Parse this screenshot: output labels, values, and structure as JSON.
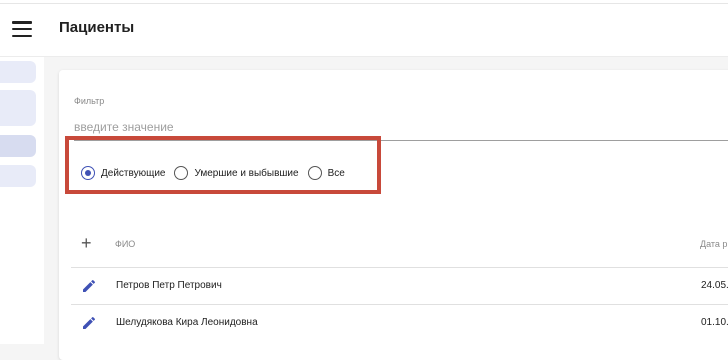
{
  "header": {
    "title": "Пациенты",
    "menu_icon": "hamburger-menu-icon"
  },
  "filter": {
    "label": "Фильтр",
    "placeholder": "введите значение",
    "value": ""
  },
  "status_filter": {
    "options": [
      "Действующие",
      "Умершие и выбывшие",
      "Все"
    ],
    "selected": "Действующие"
  },
  "table": {
    "add_icon": "plus-icon",
    "columns": [
      "ФИО",
      "Дата р"
    ],
    "rows": [
      {
        "name": "Петров Петр Петрович",
        "date": "24.05."
      },
      {
        "name": "Шелудякова Кира Леонидовна",
        "date": "01.10."
      }
    ]
  },
  "colors": {
    "accent": "#3f51b5",
    "highlight": "#c8493a",
    "sidebar_item": "#e8ebf8"
  }
}
